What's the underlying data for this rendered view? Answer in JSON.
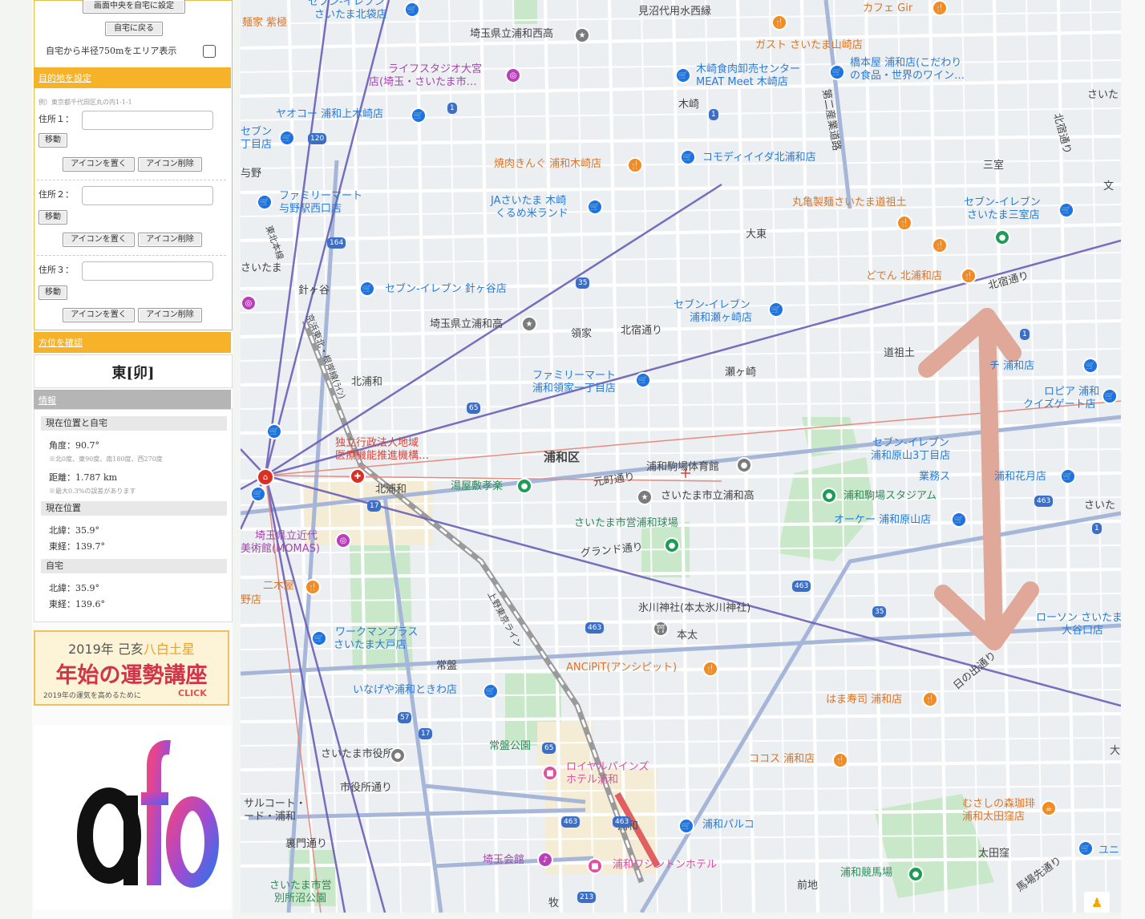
{
  "sidebar": {
    "top_buttons": [
      "画面中央を自宅に設定",
      "自宅に戻る"
    ],
    "area_toggle_label": "自宅から半径750mをエリア表示",
    "destination_header": "目的地を設定",
    "example_text": "例）東京都千代田区丸の内1-1-1",
    "addresses": [
      {
        "label": "住所１：",
        "value": "",
        "move": "移動",
        "place": "アイコンを置く",
        "remove": "アイコン削除"
      },
      {
        "label": "住所２：",
        "value": "",
        "move": "移動",
        "place": "アイコンを置く",
        "remove": "アイコン削除"
      },
      {
        "label": "住所３：",
        "value": "",
        "move": "移動",
        "place": "アイコンを置く",
        "remove": "アイコン削除"
      }
    ],
    "direction_header": "方位を確認",
    "direction_result": "東[卯]",
    "info_header": "情報",
    "info": {
      "current_home_title": "現在位置と自宅",
      "angle": "角度：90.7°",
      "angle_note": "※北0度、東90度、南180度、西270度",
      "distance": "距離：1.787 km",
      "distance_note": "※最大0.3%の誤差があります",
      "current_title": "現在位置",
      "current_lat": "北緯：35.9°",
      "current_lng": "東経：139.7°",
      "home_title": "自宅",
      "home_lat": "北緯：35.9°",
      "home_lng": "東経：139.6°"
    },
    "ad": {
      "line1": "2019年 己亥",
      "line1_accent": "八白土星",
      "line2": "年始の運勢講座",
      "line3": "2019年の運気を高めるために",
      "click": "CLICK"
    },
    "afb_logo": "afb"
  },
  "map": {
    "colors": {
      "road": "#ffffff",
      "major_road": "#8a9fcf",
      "park": "#c5e8c5",
      "line_purple": "#6a5acd",
      "line_red": "#e88a80",
      "arrow": "#e0a898"
    },
    "labels": [
      {
        "text": "セブン-イレブン",
        "cls": "blue"
      },
      {
        "text": "さいたま北袋店",
        "cls": "blue"
      },
      {
        "text": "見沼代用水西縁",
        "cls": "dark"
      },
      {
        "text": "カフェ Gir",
        "cls": "orange"
      },
      {
        "text": "麺家 紫極",
        "cls": "orange"
      },
      {
        "text": "埼玉県立浦和西高",
        "cls": "dark"
      },
      {
        "text": "ガスト さいたま山崎店",
        "cls": "orange"
      },
      {
        "text": "ライフスタジオ大宮",
        "cls": "purple"
      },
      {
        "text": "店(埼玉・さいたま市…",
        "cls": "purple"
      },
      {
        "text": "木崎食肉卸売センター",
        "cls": "blue"
      },
      {
        "text": "MEAT Meet 木崎店",
        "cls": "blue"
      },
      {
        "text": "橋本屋 浦和店(こだわり",
        "cls": "blue"
      },
      {
        "text": "の食品・世界のワイン…",
        "cls": "blue"
      },
      {
        "text": "ヤオコー 浦和上木崎店",
        "cls": "blue"
      },
      {
        "text": "木崎",
        "cls": "dark"
      },
      {
        "text": "さいた",
        "cls": "dark"
      },
      {
        "text": "セブン",
        "cls": "blue"
      },
      {
        "text": "丁目店",
        "cls": "blue"
      },
      {
        "text": "第二産業道路",
        "cls": "dark"
      },
      {
        "text": "北宿通り",
        "cls": "dark"
      },
      {
        "text": "焼肉きんぐ 浦和木崎店",
        "cls": "orange"
      },
      {
        "text": "コモディイイダ北浦和店",
        "cls": "blue"
      },
      {
        "text": "三室",
        "cls": "dark"
      },
      {
        "text": "与野",
        "cls": "dark"
      },
      {
        "text": "文",
        "cls": "dark"
      },
      {
        "text": "ファミリーマート",
        "cls": "blue"
      },
      {
        "text": "与野駅西口店",
        "cls": "blue"
      },
      {
        "text": "JAさいたま 木崎",
        "cls": "blue"
      },
      {
        "text": "くるめ米ランド",
        "cls": "blue"
      },
      {
        "text": "丸亀製麺さいたま道祖土",
        "cls": "orange"
      },
      {
        "text": "セブン-イレブン",
        "cls": "blue"
      },
      {
        "text": "さいたま三室店",
        "cls": "blue"
      },
      {
        "text": "大東",
        "cls": "dark"
      },
      {
        "text": "さいたま",
        "cls": "dark"
      },
      {
        "text": "どでん 北浦和店",
        "cls": "orange"
      },
      {
        "text": "北宿通り",
        "cls": "dark"
      },
      {
        "text": "針ヶ谷",
        "cls": "dark"
      },
      {
        "text": "セブン-イレブン 針ヶ谷店",
        "cls": "blue"
      },
      {
        "text": "セブン-イレブン",
        "cls": "blue"
      },
      {
        "text": "浦和瀬ヶ崎店",
        "cls": "blue"
      },
      {
        "text": "埼玉県立浦和高",
        "cls": "dark"
      },
      {
        "text": "領家",
        "cls": "dark"
      },
      {
        "text": "北宿通り",
        "cls": "dark"
      },
      {
        "text": "道祖土",
        "cls": "dark"
      },
      {
        "text": "北浦和",
        "cls": "dark"
      },
      {
        "text": "ファミリーマート",
        "cls": "blue"
      },
      {
        "text": "浦和領家一丁目店",
        "cls": "blue"
      },
      {
        "text": "瀬ヶ崎",
        "cls": "dark"
      },
      {
        "text": "チ 浦和店",
        "cls": "blue"
      },
      {
        "text": "ロピア 浦和",
        "cls": "blue"
      },
      {
        "text": "クイズゲート店",
        "cls": "blue"
      },
      {
        "text": "独立行政法人地域",
        "cls": "red"
      },
      {
        "text": "医療機能推進機構…",
        "cls": "red"
      },
      {
        "text": "浦和区",
        "cls": "dark"
      },
      {
        "text": "セブン-イレブン",
        "cls": "blue"
      },
      {
        "text": "浦和原山3丁目店",
        "cls": "blue"
      },
      {
        "text": "浦和駒場体育館",
        "cls": "dark"
      },
      {
        "text": "元町通り",
        "cls": "dark"
      },
      {
        "text": "北浦和",
        "cls": "dark"
      },
      {
        "text": "湯屋敷孝楽",
        "cls": "green"
      },
      {
        "text": "業務ス",
        "cls": "blue"
      },
      {
        "text": "浦和花月店",
        "cls": "blue"
      },
      {
        "text": "さいたま市立浦和高",
        "cls": "dark"
      },
      {
        "text": "浦和駒場スタジアム",
        "cls": "green"
      },
      {
        "text": "さいた",
        "cls": "dark"
      },
      {
        "text": "オーケー 浦和原山店",
        "cls": "blue"
      },
      {
        "text": "さいたま市営浦和球場",
        "cls": "green"
      },
      {
        "text": "埼玉県立近代",
        "cls": "purple"
      },
      {
        "text": "美術館(MOMAS)",
        "cls": "purple"
      },
      {
        "text": "グランド通り",
        "cls": "dark"
      },
      {
        "text": "二木屋",
        "cls": "orange"
      },
      {
        "text": "野店",
        "cls": "orange"
      },
      {
        "text": "氷川神社(本太氷川神社)",
        "cls": "dark"
      },
      {
        "text": "本太",
        "cls": "dark"
      },
      {
        "text": "ローソン さいたま",
        "cls": "blue"
      },
      {
        "text": "大谷口店",
        "cls": "blue"
      },
      {
        "text": "ワークマンプラス",
        "cls": "blue"
      },
      {
        "text": "さいたま大戸店",
        "cls": "blue"
      },
      {
        "text": "常盤",
        "cls": "dark"
      },
      {
        "text": "ANCiPiT(アンシピット)",
        "cls": "orange"
      },
      {
        "text": "日の出通り",
        "cls": "dark"
      },
      {
        "text": "いなげや浦和ときわ店",
        "cls": "blue"
      },
      {
        "text": "はま寿司 浦和店",
        "cls": "orange"
      },
      {
        "text": "常盤公園",
        "cls": "green"
      },
      {
        "text": "さいたま市役所",
        "cls": "dark"
      },
      {
        "text": "ロイヤルパインズ",
        "cls": "pk"
      },
      {
        "text": "ホテル浦和",
        "cls": "pk"
      },
      {
        "text": "ココス 浦和店",
        "cls": "orange"
      },
      {
        "text": "大",
        "cls": "dark"
      },
      {
        "text": "市役所通り",
        "cls": "dark"
      },
      {
        "text": "サルコート・",
        "cls": "dark"
      },
      {
        "text": "ード・浦和",
        "cls": "dark"
      },
      {
        "text": "むさしの森珈琲",
        "cls": "orange"
      },
      {
        "text": "浦和太田窪店",
        "cls": "orange"
      },
      {
        "text": "浦和",
        "cls": "dark"
      },
      {
        "text": "浦和パルコ",
        "cls": "blue"
      },
      {
        "text": "裏門通り",
        "cls": "dark"
      },
      {
        "text": "埼玉会館",
        "cls": "purple"
      },
      {
        "text": "浦和ワシントンホテル",
        "cls": "pk"
      },
      {
        "text": "浦和競馬場",
        "cls": "green"
      },
      {
        "text": "太田窪",
        "cls": "dark"
      },
      {
        "text": "馬場先通り",
        "cls": "dark"
      },
      {
        "text": "ユニ",
        "cls": "blue"
      },
      {
        "text": "さいたま市営",
        "cls": "green"
      },
      {
        "text": "別所沼公園",
        "cls": "green"
      },
      {
        "text": "前地",
        "cls": "dark"
      },
      {
        "text": "牧",
        "cls": "dark"
      },
      {
        "text": "上野東京ライン",
        "cls": "dark"
      },
      {
        "text": "東北本線",
        "cls": "dark"
      },
      {
        "text": "京浜東北・根岸線(ﾗｲﾝ)",
        "cls": "dark"
      }
    ],
    "route_numbers": [
      "120",
      "164",
      "1",
      "35",
      "65",
      "17",
      "463",
      "463",
      "463",
      "35",
      "463",
      "57",
      "17",
      "213",
      "65",
      "463",
      "1",
      "1",
      "1"
    ]
  }
}
